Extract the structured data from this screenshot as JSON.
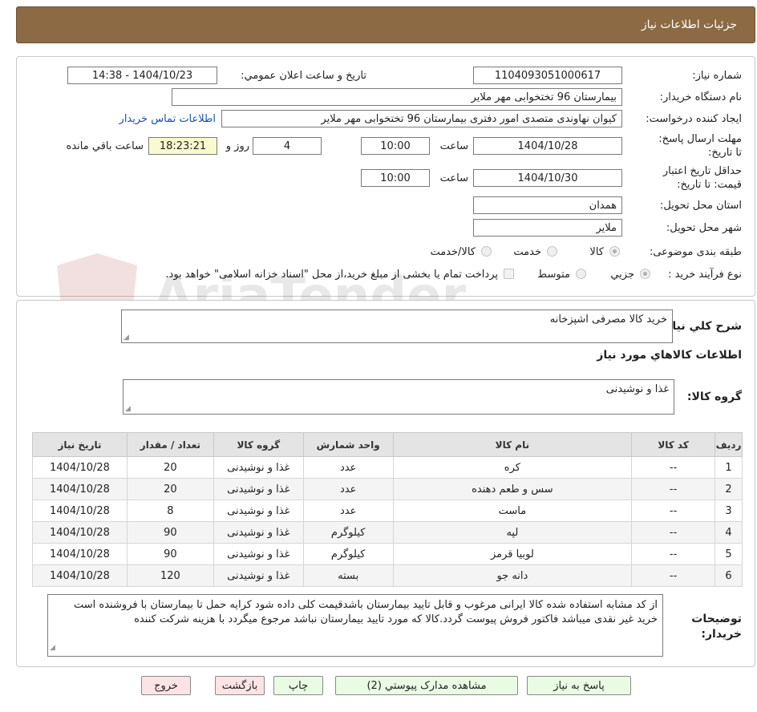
{
  "page_title": "جزئیات اطلاعات نیاز",
  "fields": {
    "need_number_label": "شماره نیاز:",
    "need_number": "1104093051000617",
    "announce_label": "تاریخ و ساعت اعلان عمومي:",
    "announce_value": "1404/10/23 - 14:38",
    "buyer_org_label": "نام دستگاه خریدار:",
    "buyer_org": "بیمارستان 96 تختخوابی مهر ملایر",
    "requester_label": "ایجاد کننده درخواست:",
    "requester": "کیوان نهاوندی متصدی امور دفتری بیمارستان 96 تختخوابی مهر ملایر",
    "contact_link": "اطلاعات تماس خریدار",
    "deadline_label": "مهلت ارسال پاسخ: تا تاریخ:",
    "deadline_date": "1404/10/28",
    "time_label": "ساعت",
    "deadline_time": "10:00",
    "days_value": "4",
    "days_label": "روز و",
    "remaining_time": "18:23:21",
    "remaining_label": "ساعت باقي مانده",
    "validity_label": "حداقل تاریخ اعتبار قیمت: تا تاریخ:",
    "validity_date": "1404/10/30",
    "validity_time": "10:00",
    "province_label": "استان محل تحویل:",
    "province": "همدان",
    "city_label": "شهر محل تحویل:",
    "city": "ملایر",
    "category_label": "طبقه بندی موضوعی:",
    "category_options": [
      "کالا",
      "خدمت",
      "کالا/خدمت"
    ],
    "process_label": "نوع فرآیند خرید :",
    "process_options": [
      "جزیي",
      "متوسط"
    ],
    "payment_note": "پرداخت تمام یا بخشی از مبلغ خرید،از محل \"اسناد خزانه اسلامی\" خواهد بود."
  },
  "watermark": "AriaTender.net",
  "section2": {
    "summary_label": "شرح کلي نیاز:",
    "summary": "خرید کالا مصرفی اشپزخانه",
    "items_heading": "اطلاعات کالاهاي مورد نیاز",
    "group_label": "گروه کالا:",
    "group": "غذا و نوشیدنی"
  },
  "table": {
    "headers": [
      "ردیف",
      "کد کالا",
      "نام کالا",
      "واحد شمارش",
      "گروه کالا",
      "تعداد / مقدار",
      "تاریخ نیاز"
    ],
    "rows": [
      [
        "1",
        "--",
        "کره",
        "عدد",
        "غذا و نوشیدنی",
        "20",
        "1404/10/28"
      ],
      [
        "2",
        "--",
        "سس و طعم دهنده",
        "عدد",
        "غذا و نوشیدنی",
        "20",
        "1404/10/28"
      ],
      [
        "3",
        "--",
        "ماست",
        "عدد",
        "غذا و نوشیدنی",
        "8",
        "1404/10/28"
      ],
      [
        "4",
        "--",
        "لپه",
        "کیلوگرم",
        "غذا و نوشیدنی",
        "90",
        "1404/10/28"
      ],
      [
        "5",
        "--",
        "لوبیا قرمز",
        "کیلوگرم",
        "غذا و نوشیدنی",
        "90",
        "1404/10/28"
      ],
      [
        "6",
        "--",
        "دانه جو",
        "بسته",
        "غذا و نوشیدنی",
        "120",
        "1404/10/28"
      ]
    ]
  },
  "notes": {
    "label": "توضیحات خریدار:",
    "text": "از کد مشابه استفاده شده کالا ایرانی مرغوب و قابل تایید بیمارستان باشدقیمت کلی داده شود کرایه حمل تا بیمارستان با فروشنده است خرید غیر نقدی میباشد فاکتور فروش پیوست گردد.کالا که مورد تایید بیمارستان نباشد مرجوع میگردد با هزینه شرکت کننده"
  },
  "buttons": {
    "reply": "پاسخ به نیاز",
    "attachments": "مشاهده مدارک پیوستي (2)",
    "print": "چاپ",
    "back": "بازگشت",
    "exit": "خروج"
  },
  "colors": {
    "titlebar": "#8c6a43",
    "green_button": "#eafbe3",
    "pink_button": "#fbe3e6",
    "link": "#1a4fb5"
  }
}
